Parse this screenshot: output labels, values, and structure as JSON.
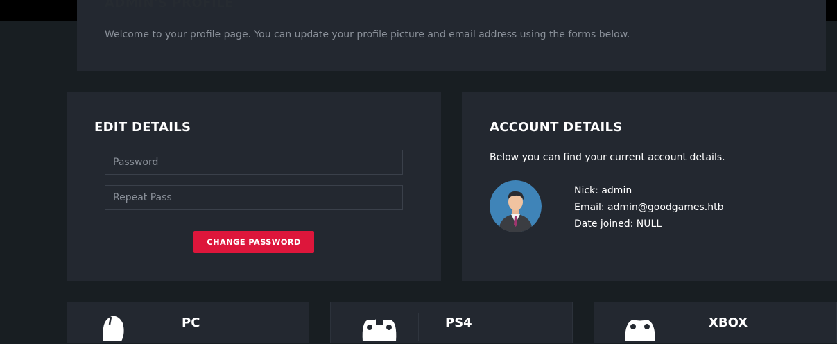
{
  "profile": {
    "title": "ADMIN'S PROFILE",
    "intro": "Welcome to your profile page. You can update your profile picture and email address using the forms below."
  },
  "edit_details": {
    "title": "EDIT DETAILS",
    "password_placeholder": "Password",
    "repeat_placeholder": "Repeat Pass",
    "button_label": "CHANGE PASSWORD"
  },
  "account_details": {
    "title": "ACCOUNT DETAILS",
    "intro": "Below you can find your current account details.",
    "nick": "Nick: admin",
    "email": "Email: admin@goodgames.htb",
    "date_joined": "Date joined: NULL",
    "avatar_icon": "user-avatar-icon"
  },
  "platforms": [
    {
      "label": "PC",
      "icon": "mouse-icon"
    },
    {
      "label": "PS4",
      "icon": "gamepad-icon"
    },
    {
      "label": "XBOX",
      "icon": "xbox-controller-icon"
    }
  ],
  "colors": {
    "background": "#181e22",
    "panel": "#232830",
    "accent": "#dd163b",
    "topbar": "#000000"
  }
}
